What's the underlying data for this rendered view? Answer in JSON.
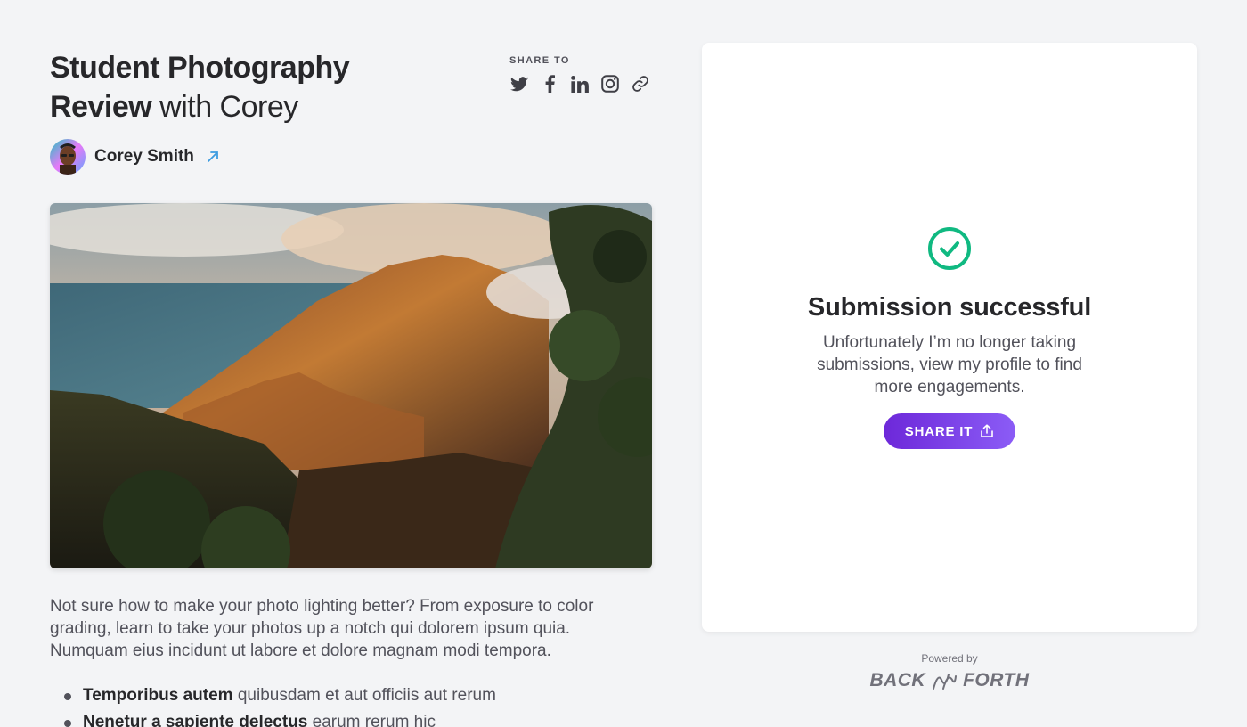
{
  "header": {
    "title_bold_1": "Student Photography",
    "title_bold_2": "Review",
    "title_light": "with Corey"
  },
  "share": {
    "label": "SHARE TO",
    "icons": [
      "twitter-icon",
      "facebook-icon",
      "linkedin-icon",
      "instagram-icon",
      "link-icon"
    ]
  },
  "author": {
    "name": "Corey Smith",
    "avatar_icon": "avatar"
  },
  "photo": {
    "description": "landscape photo"
  },
  "description": "Not sure how to make your photo lighting better? From exposure to color grading, learn to take your photos up a notch qui dolorem ipsum quia. Numquam eius incidunt ut labore et dolore magnam modi tempora.",
  "bullets": [
    {
      "bold": "Temporibus autem",
      "text": " quibusdam et aut officiis aut rerum"
    },
    {
      "bold": "Nenetur a sapiente delectus",
      "text": " earum rerum hic"
    }
  ],
  "card": {
    "title": "Submission successful",
    "message": "Unfortunately I’m no longer taking submissions, view my profile to find more engagements.",
    "button_label": "SHARE IT"
  },
  "footer": {
    "powered_label": "Powered by",
    "logo_left": "BACK",
    "logo_right": "FORTH"
  },
  "colors": {
    "accent": "#7c3aed",
    "success": "#10b981",
    "link": "#3b9be0",
    "background": "#f3f4f6"
  }
}
